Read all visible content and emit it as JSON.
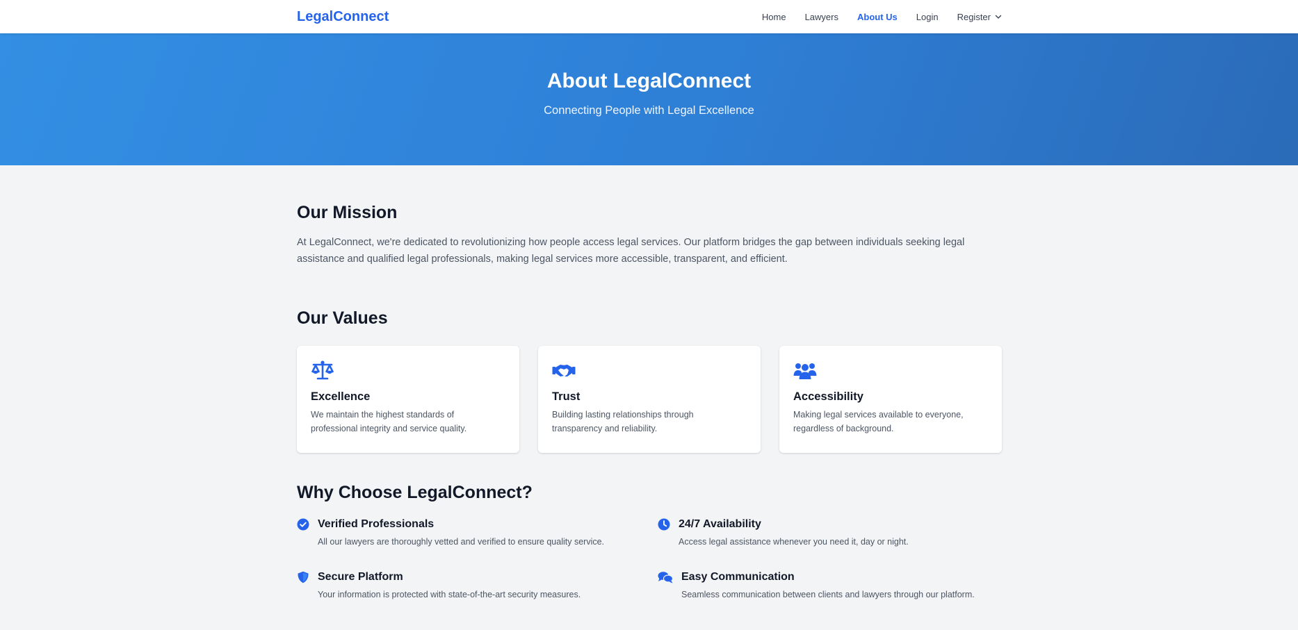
{
  "nav": {
    "brand": "LegalConnect",
    "links": [
      {
        "label": "Home"
      },
      {
        "label": "Lawyers"
      },
      {
        "label": "About Us"
      },
      {
        "label": "Login"
      },
      {
        "label": "Register"
      }
    ],
    "active": "About Us"
  },
  "hero": {
    "title": "About LegalConnect",
    "subtitle": "Connecting People with Legal Excellence"
  },
  "mission": {
    "heading": "Our Mission",
    "text": "At LegalConnect, we're dedicated to revolutionizing how people access legal services. Our platform bridges the gap between individuals seeking legal assistance and qualified legal professionals, making legal services more accessible, transparent, and efficient."
  },
  "values": {
    "heading": "Our Values",
    "cards": [
      {
        "icon": "scale-icon",
        "title": "Excellence",
        "text": "We maintain the highest standards of professional integrity and service quality."
      },
      {
        "icon": "handshake-icon",
        "title": "Trust",
        "text": "Building lasting relationships through transparency and reliability."
      },
      {
        "icon": "users-icon",
        "title": "Accessibility",
        "text": "Making legal services available to everyone, regardless of background."
      }
    ]
  },
  "why": {
    "heading": "Why Choose LegalConnect?",
    "items": [
      {
        "icon": "check-circle-icon",
        "title": "Verified Professionals",
        "text": "All our lawyers are thoroughly vetted and verified to ensure quality service."
      },
      {
        "icon": "clock-icon",
        "title": "24/7 Availability",
        "text": "Access legal assistance whenever you need it, day or night."
      },
      {
        "icon": "shield-icon",
        "title": "Secure Platform",
        "text": "Your information is protected with state-of-the-art security measures."
      },
      {
        "icon": "chat-icon",
        "title": "Easy Communication",
        "text": "Seamless communication between clients and lawyers through our platform."
      }
    ]
  },
  "colors": {
    "accent": "#2563eb",
    "hero_start": "#338fe3",
    "hero_end": "#2b6bb8",
    "page_bg": "#f3f4f6"
  }
}
